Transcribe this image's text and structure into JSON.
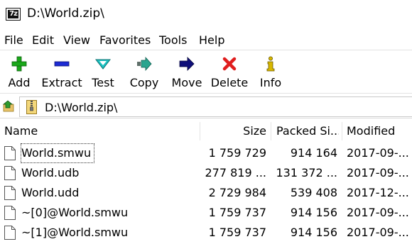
{
  "window": {
    "title": "D:\\World.zip\\"
  },
  "menu": [
    "File",
    "Edit",
    "View",
    "Favorites",
    "Tools",
    "Help"
  ],
  "toolbar": {
    "add": "Add",
    "extract": "Extract",
    "test": "Test",
    "copy": "Copy",
    "move": "Move",
    "delete": "Delete",
    "info": "Info"
  },
  "colors": {
    "add": "#1aa81a",
    "extract": "#1d2bd4",
    "test": "#1cc2c2",
    "copy": "#2aa58f",
    "move": "#10107a",
    "delete": "#e01e1e",
    "info": "#d8b800"
  },
  "address": {
    "path": "D:\\World.zip\\"
  },
  "columns": {
    "name": "Name",
    "size": "Size",
    "packed": "Packed Si...",
    "modified": "Modified"
  },
  "files": [
    {
      "name": "World.smwu",
      "size": "1 759 729",
      "packed": "914 164",
      "modified": "2017-09-..."
    },
    {
      "name": "World.udb",
      "size": "277 819 ...",
      "packed": "131 372 ...",
      "modified": "2017-09-..."
    },
    {
      "name": "World.udd",
      "size": "2 729 984",
      "packed": "539 408",
      "modified": "2017-12-..."
    },
    {
      "name": "~[0]@World.smwu",
      "size": "1 759 737",
      "packed": "914 156",
      "modified": "2017-09-..."
    },
    {
      "name": "~[1]@World.smwu",
      "size": "1 759 737",
      "packed": "914 156",
      "modified": "2017-09-..."
    }
  ]
}
